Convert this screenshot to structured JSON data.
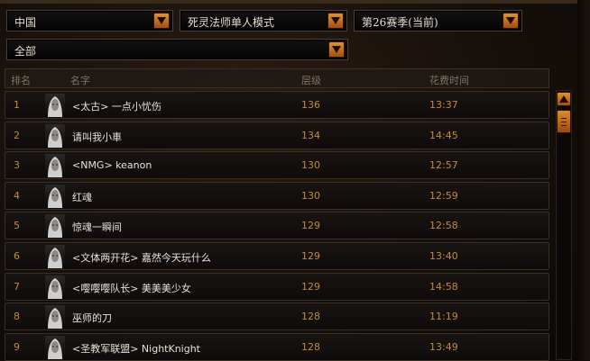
{
  "filters": {
    "region": "中国",
    "mode": "死灵法师单人模式",
    "season": "第26赛季(当前)",
    "scope": "全部"
  },
  "icons": {
    "dropdown": "chevron-down-icon",
    "scroll_up": "arrow-up-icon",
    "scroll_thumb": "scroll-thumb-grip-icon",
    "avatar": "necromancer-portrait-icon"
  },
  "colors": {
    "accent": "#c28a3a",
    "button": "#d07a22"
  },
  "table": {
    "headers": {
      "rank": "排名",
      "name": "名字",
      "level": "层级",
      "time": "花费时间"
    },
    "rows": [
      {
        "rank": "1",
        "name": "<太古> 一点小忧伤",
        "level": "136",
        "time": "13:37"
      },
      {
        "rank": "2",
        "name": "请叫我小車",
        "level": "134",
        "time": "14:45"
      },
      {
        "rank": "3",
        "name": "<NMG> keanon",
        "level": "130",
        "time": "12:57"
      },
      {
        "rank": "4",
        "name": "红魂",
        "level": "130",
        "time": "12:59"
      },
      {
        "rank": "5",
        "name": "惊魂一瞬间",
        "level": "129",
        "time": "12:58"
      },
      {
        "rank": "6",
        "name": "<文体两开花> 嘉然今天玩什么",
        "level": "129",
        "time": "13:40"
      },
      {
        "rank": "7",
        "name": "<嘤嘤嘤队长> 美美美少女",
        "level": "129",
        "time": "14:58"
      },
      {
        "rank": "8",
        "name": "巫师的刀",
        "level": "128",
        "time": "11:19"
      },
      {
        "rank": "9",
        "name": "<圣教军联盟> NightKnight",
        "level": "128",
        "time": "13:49"
      }
    ]
  }
}
